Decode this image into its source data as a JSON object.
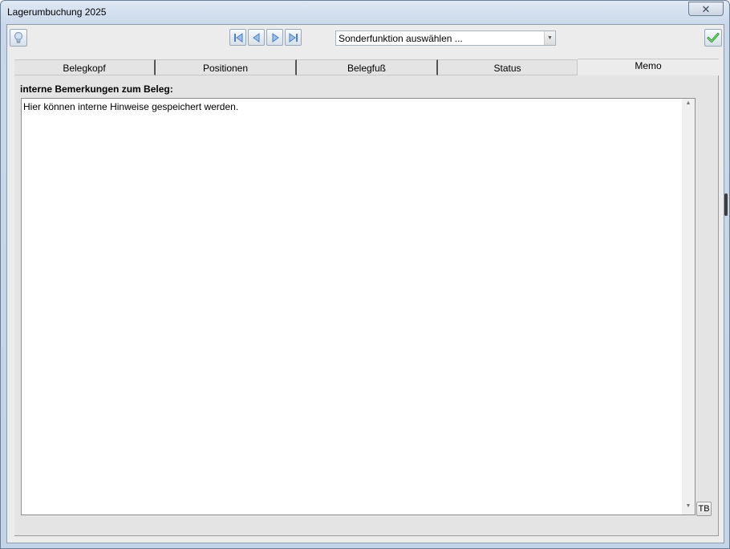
{
  "window": {
    "title": "Lagerumbuchung 2025",
    "close_glyph": "✕"
  },
  "toolbar": {
    "hint_icon": "lightbulb-icon",
    "nav": {
      "first_icon": "first-record-icon",
      "prev_icon": "previous-record-icon",
      "next_icon": "next-record-icon",
      "last_icon": "last-record-icon"
    },
    "special_function": {
      "selected": "Sonderfunktion auswählen ...",
      "arrow_glyph": "▼"
    },
    "confirm_icon": "checkmark-icon"
  },
  "tabs": [
    {
      "label": "Belegkopf",
      "active": false
    },
    {
      "label": "Positionen",
      "active": false
    },
    {
      "label": "Belegfuß",
      "active": false
    },
    {
      "label": "Status",
      "active": false
    },
    {
      "label": "Memo",
      "active": true
    }
  ],
  "memo": {
    "label": "interne Bemerkungen zum Beleg:",
    "value": "Hier können interne Hinweise gespeichert werden.",
    "scroll_up_glyph": "▲",
    "scroll_down_glyph": "▼",
    "tb_button_label": "TB"
  },
  "colors": {
    "nav_arrow": "#4a7fc1",
    "check": "#2e9b2e"
  }
}
